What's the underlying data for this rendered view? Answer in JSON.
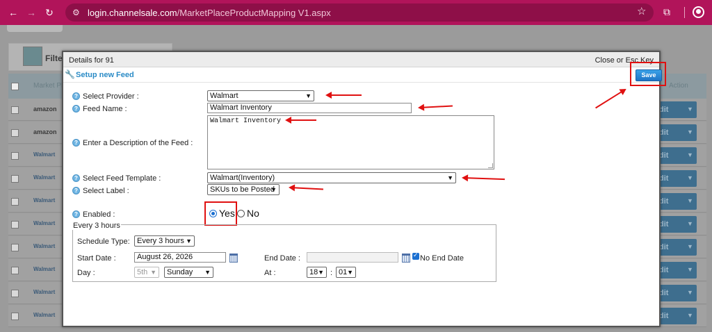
{
  "browser": {
    "url_host": "login.channelsale.com",
    "url_path": "/MarketPlaceProductMapping V1.aspx"
  },
  "background": {
    "filter_label": "Filte",
    "header_marketplace": "Market Pla",
    "header_action": "Action",
    "rows": [
      {
        "logo": "amazon",
        "edit": "dit"
      },
      {
        "logo": "amazon",
        "edit": "dit"
      },
      {
        "logo": "Walmart",
        "edit": "dit"
      },
      {
        "logo": "Walmart",
        "edit": "dit"
      },
      {
        "logo": "Walmart",
        "edit": "dit"
      },
      {
        "logo": "Walmart",
        "edit": "dit"
      },
      {
        "logo": "Walmart",
        "edit": "dit"
      },
      {
        "logo": "Walmart",
        "edit": "dit"
      },
      {
        "logo": "Walmart",
        "edit": "dit"
      },
      {
        "logo": "Walmart",
        "edit": "dit"
      }
    ]
  },
  "modal": {
    "title": "Details for 91",
    "close_label": "Close",
    "close_or": "or",
    "esc_label": "Esc Key",
    "feed_title": "Setup new Feed",
    "save_label": "Save",
    "form": {
      "provider_label": "Select Provider :",
      "provider_value": "Walmart",
      "feed_name_label": "Feed Name :",
      "feed_name_value": "Walmart Inventory",
      "description_label": "Enter a Description of the Feed :",
      "description_value": "Walmart Inventory",
      "template_label": "Select Feed Template :",
      "template_value": "Walmart(Inventory)",
      "label_label": "Select Label :",
      "label_value": "SKUs to be Posted",
      "enabled_label": "Enabled :",
      "yes_label": "Yes",
      "no_label": "No"
    },
    "schedule": {
      "legend": "Every 3 hours",
      "schedule_type_label": "Schedule Type:",
      "schedule_type_value": "Every 3 hours",
      "start_date_label": "Start Date :",
      "start_date_value": "August 26, 2026",
      "end_date_label": "End Date :",
      "end_date_value": "",
      "no_end_date_label": "No End Date",
      "day_label": "Day :",
      "day_num_value": "5th",
      "day_name_value": "Sunday",
      "at_label": "At :",
      "hour_value": "18",
      "time_sep": ":",
      "minute_value": "01"
    }
  }
}
